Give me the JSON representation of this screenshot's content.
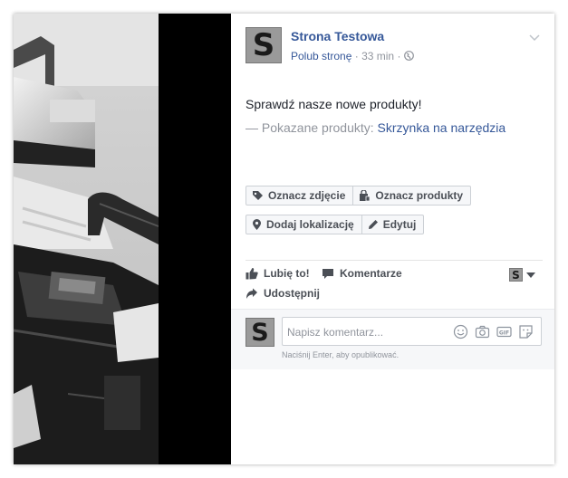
{
  "post": {
    "page_name": "Strona Testowa",
    "avatar_letter": "S",
    "like_page_label": "Polub stronę",
    "separator": "·",
    "time": "33 min",
    "separator2": "·",
    "text": "Sprawdź nasze nowe produkty!",
    "products_prefix": "— Pokazane produkty: ",
    "product_link": "Skrzynka na narzędzia"
  },
  "buttons": {
    "tag_photo": "Oznacz zdjęcie",
    "tag_products": "Oznacz produkty",
    "add_location": "Dodaj lokalizację",
    "edit": "Edytuj"
  },
  "actions": {
    "like": "Lubię to!",
    "comment": "Komentarze",
    "share": "Udostępnij"
  },
  "comment": {
    "placeholder": "Napisz komentarz...",
    "hint": "Naciśnij Enter, aby opublikować."
  },
  "icons": [
    "globe-icon",
    "chevron-down-icon",
    "tag-icon",
    "shopping-bag-icon",
    "location-pin-icon",
    "pencil-icon",
    "thumbs-up-icon",
    "comment-bubble-icon",
    "share-arrow-icon",
    "smiley-icon",
    "camera-icon",
    "gif-icon",
    "sticker-icon"
  ],
  "colors": {
    "link": "#365899",
    "muted": "#90949c",
    "text": "#1d2129",
    "button_text": "#4b4f56"
  }
}
